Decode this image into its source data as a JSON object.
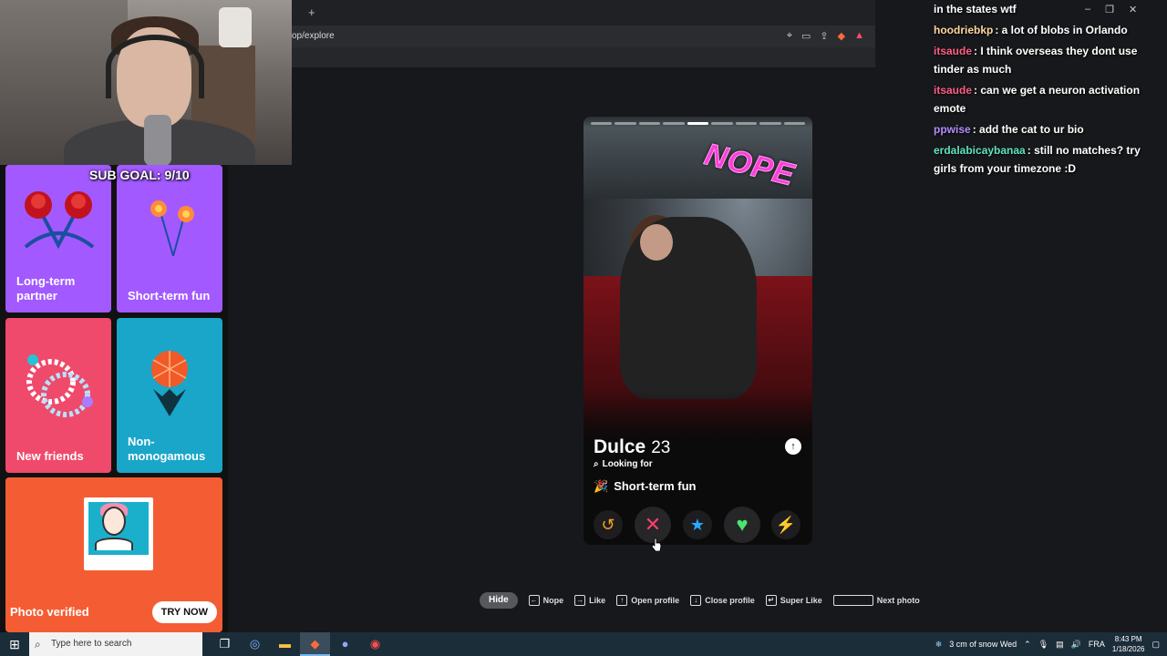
{
  "browser": {
    "new_tab_label": "+",
    "url": "op/explore"
  },
  "stream": {
    "sub_goal": "SUB GOAL: 9/10"
  },
  "relationship_options": [
    {
      "label": "Long-term partner",
      "color": "#a259ff"
    },
    {
      "label": "Short-term fun",
      "color": "#a259ff"
    },
    {
      "label": "New friends",
      "color": "#ef4a6b"
    },
    {
      "label": "Non-monogamous",
      "color": "#19a6c9"
    }
  ],
  "verify_card": {
    "label": "Photo verified",
    "button": "TRY NOW",
    "color": "#f45d33"
  },
  "profile": {
    "name": "Dulce",
    "age": "23",
    "stamp": "NOPE",
    "looking_for_label": "Looking for",
    "looking_for_value": "Short-term fun",
    "photo_count": 9,
    "active_photo": 5
  },
  "actions": [
    {
      "name": "rewind",
      "glyph": "↺",
      "color": "#f5a623"
    },
    {
      "name": "nope",
      "glyph": "✕",
      "color": "#ff3e6c"
    },
    {
      "name": "super-like",
      "glyph": "★",
      "color": "#2aa8ff"
    },
    {
      "name": "like",
      "glyph": "♥",
      "color": "#49e56d"
    },
    {
      "name": "boost",
      "glyph": "⚡",
      "color": "#b84dff"
    }
  ],
  "shortcuts": {
    "hide": "Hide",
    "nope": "Nope",
    "like": "Like",
    "open_profile": "Open profile",
    "close_profile": "Close profile",
    "super_like": "Super Like",
    "next_photo": "Next photo"
  },
  "chat": [
    {
      "user": "",
      "user_color": "#7ee08f",
      "text": "in the states wtf"
    },
    {
      "user": "hoodriebkp",
      "user_color": "#ffd6a0",
      "text": ": a lot of blobs in Orlando"
    },
    {
      "user": "itsaude",
      "user_color": "#ff5e86",
      "text": ": I think overseas they dont use tinder as much"
    },
    {
      "user": "itsaude",
      "user_color": "#ff5e86",
      "text": ": can we get a neuron activation emote"
    },
    {
      "user": "ppwise",
      "user_color": "#b48cff",
      "text": ": add the cat to ur bio"
    },
    {
      "user": "erdalabicaybanaa",
      "user_color": "#5fe3c0",
      "text": ": still no matches? try girls from your timezone :D"
    }
  ],
  "taskbar": {
    "search_placeholder": "Type here to search",
    "weather": "3 cm of snow Wed",
    "language": "FRA",
    "time": "8:43 PM",
    "date": "1/18/2026"
  }
}
